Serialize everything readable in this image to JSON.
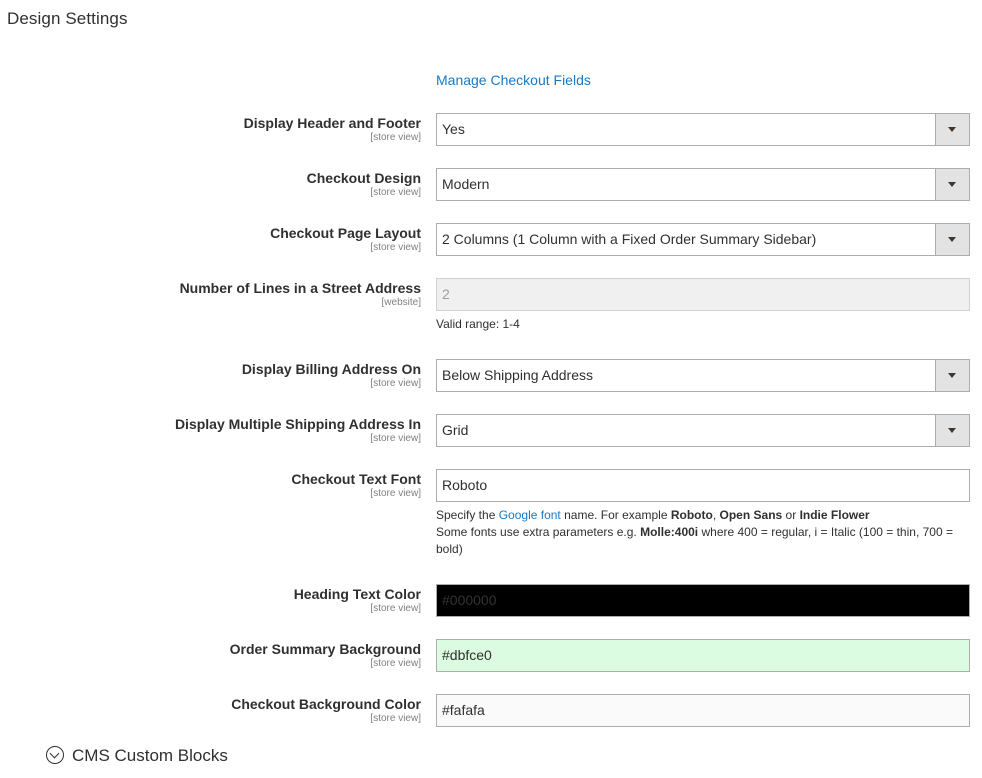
{
  "section": {
    "title": "Design Settings"
  },
  "manage_link": "Manage Checkout Fields",
  "fields": {
    "header_footer": {
      "label": "Display Header and Footer",
      "scope": "[store view]",
      "value": "Yes"
    },
    "checkout_design": {
      "label": "Checkout Design",
      "scope": "[store view]",
      "value": "Modern"
    },
    "page_layout": {
      "label": "Checkout Page Layout",
      "scope": "[store view]",
      "value": "2 Columns (1 Column with a Fixed Order Summary Sidebar)"
    },
    "street_lines": {
      "label": "Number of Lines in a Street Address",
      "scope": "[website]",
      "value": "2",
      "note": "Valid range: 1-4"
    },
    "billing_address": {
      "label": "Display Billing Address On",
      "scope": "[store view]",
      "value": "Below Shipping Address"
    },
    "multi_shipping": {
      "label": "Display Multiple Shipping Address In",
      "scope": "[store view]",
      "value": "Grid"
    },
    "text_font": {
      "label": "Checkout Text Font",
      "scope": "[store view]",
      "value": "Roboto",
      "note": {
        "specify": "Specify the",
        "google_link": "Google font",
        "name_example": "name. For example",
        "font1": "Roboto",
        "comma": ",",
        "font2": "Open Sans",
        "or": "or",
        "font3": "Indie Flower",
        "extra": "Some fonts use extra parameters e.g.",
        "param": "Molle:400i",
        "explain": "where 400 = regular, i = Italic (100 = thin, 700 = bold)"
      }
    },
    "heading_color": {
      "label": "Heading Text Color",
      "scope": "[store view]",
      "value": "#000000",
      "bg": "#000000",
      "fg": "#333333"
    },
    "summary_bg": {
      "label": "Order Summary Background",
      "scope": "[store view]",
      "value": "#dbfce0",
      "bg": "#dbfce0",
      "fg": "#303030"
    },
    "checkout_bg": {
      "label": "Checkout Background Color",
      "scope": "[store view]",
      "value": "#fafafa",
      "bg": "#fafafa",
      "fg": "#303030"
    }
  },
  "cms_blocks": {
    "label": "CMS Custom Blocks"
  }
}
